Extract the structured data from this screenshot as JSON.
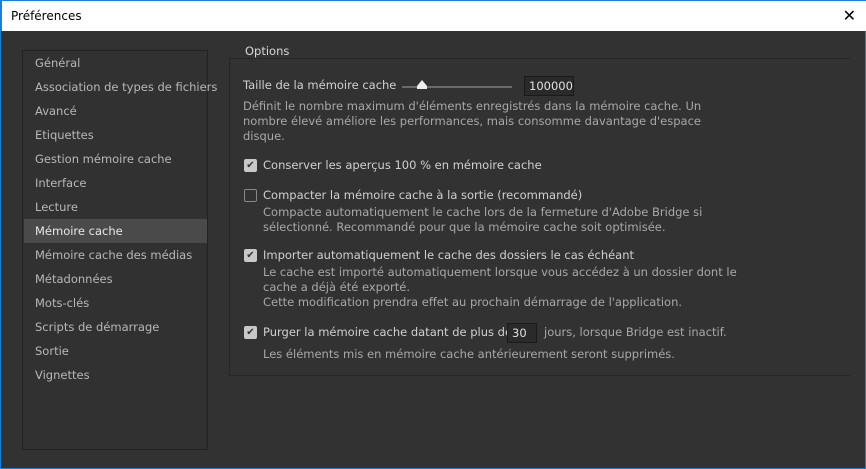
{
  "window": {
    "title": "Préférences",
    "close": "✕"
  },
  "sidebar": {
    "items": [
      {
        "label": "Général"
      },
      {
        "label": "Association de types de fichiers"
      },
      {
        "label": "Avancé"
      },
      {
        "label": "Etiquettes"
      },
      {
        "label": "Gestion mémoire cache"
      },
      {
        "label": "Interface"
      },
      {
        "label": "Lecture"
      },
      {
        "label": "Mémoire cache",
        "selected": true
      },
      {
        "label": "Mémoire cache des médias"
      },
      {
        "label": "Métadonnées"
      },
      {
        "label": "Mots-clés"
      },
      {
        "label": "Scripts de démarrage"
      },
      {
        "label": "Sortie"
      },
      {
        "label": "Vignettes"
      }
    ]
  },
  "options": {
    "legend": "Options",
    "cache_size_label": "Taille de la mémoire cache",
    "cache_size_value": "100000",
    "cache_size_slider_fraction": 0.17,
    "cache_size_desc": [
      "Définit le nombre maximum d'éléments enregistrés dans la mémoire cache. Un",
      "nombre élevé améliore les performances, mais consomme davantage d'espace",
      "disque."
    ],
    "keep_previews": {
      "label": "Conserver les aperçus 100 % en mémoire cache",
      "checked": true
    },
    "compact": {
      "label": "Compacter la mémoire cache à la sortie (recommandé)",
      "checked": false,
      "desc": [
        "Compacte automatiquement le cache lors de la fermeture d'Adobe Bridge si",
        "sélectionné. Recommandé pour que la mémoire cache soit optimisée."
      ]
    },
    "import": {
      "label": "Importer automatiquement le cache des dossiers le cas échéant",
      "checked": true,
      "desc": [
        "Le cache est importé automatiquement lorsque vous accédez à un dossier dont le",
        "cache a déjà été exporté.",
        "Cette modification prendra effet au prochain démarrage de l'application."
      ]
    },
    "purge": {
      "label": "Purger la mémoire cache datant de plus de",
      "days": "30",
      "suffix": "jours, lorsque Bridge est inactif.",
      "checked": true,
      "desc": "Les éléments mis en mémoire cache antérieurement seront supprimés."
    }
  },
  "check_glyph": "✔"
}
